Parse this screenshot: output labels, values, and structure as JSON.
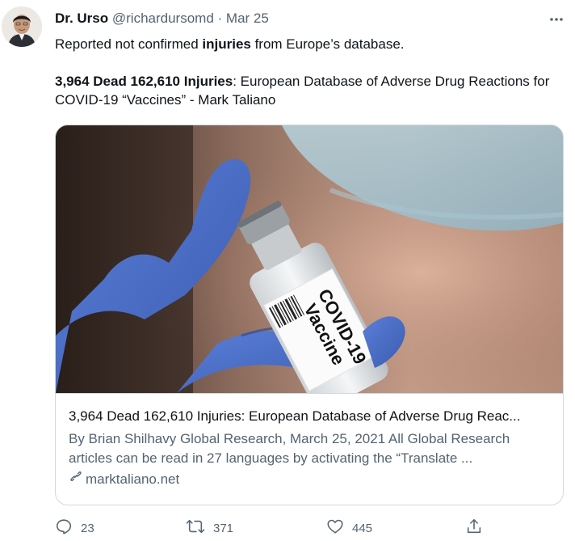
{
  "author": {
    "name": "Dr. Urso",
    "handle": "@richardursomd",
    "separator": "·",
    "date": "Mar 25"
  },
  "tweet": {
    "line1_prefix": "Reported not confirmed ",
    "line1_bold": "injuries",
    "line1_suffix": " from Europe’s database.",
    "line2_bold": "3,964 Dead 162,610 Injuries",
    "line2_rest": ": European Database of Adverse Drug Reactions for COVID-19 “Vaccines” - Mark Taliano"
  },
  "card": {
    "vial_label_line1": "COVID-19",
    "vial_label_line2": "Vaccine",
    "title": "3,964 Dead 162,610 Injuries: European Database of Adverse Drug Reac...",
    "description": "By Brian Shilhavy Global Research, March 25, 2021 All Global Research articles can be read in 27 languages by activating the “Translate ...",
    "domain": "marktaliano.net"
  },
  "actions": {
    "reply_count": "23",
    "retweet_count": "371",
    "like_count": "445"
  },
  "icons": [
    "more-icon",
    "reply-icon",
    "retweet-icon",
    "like-icon",
    "share-icon",
    "link-icon"
  ]
}
